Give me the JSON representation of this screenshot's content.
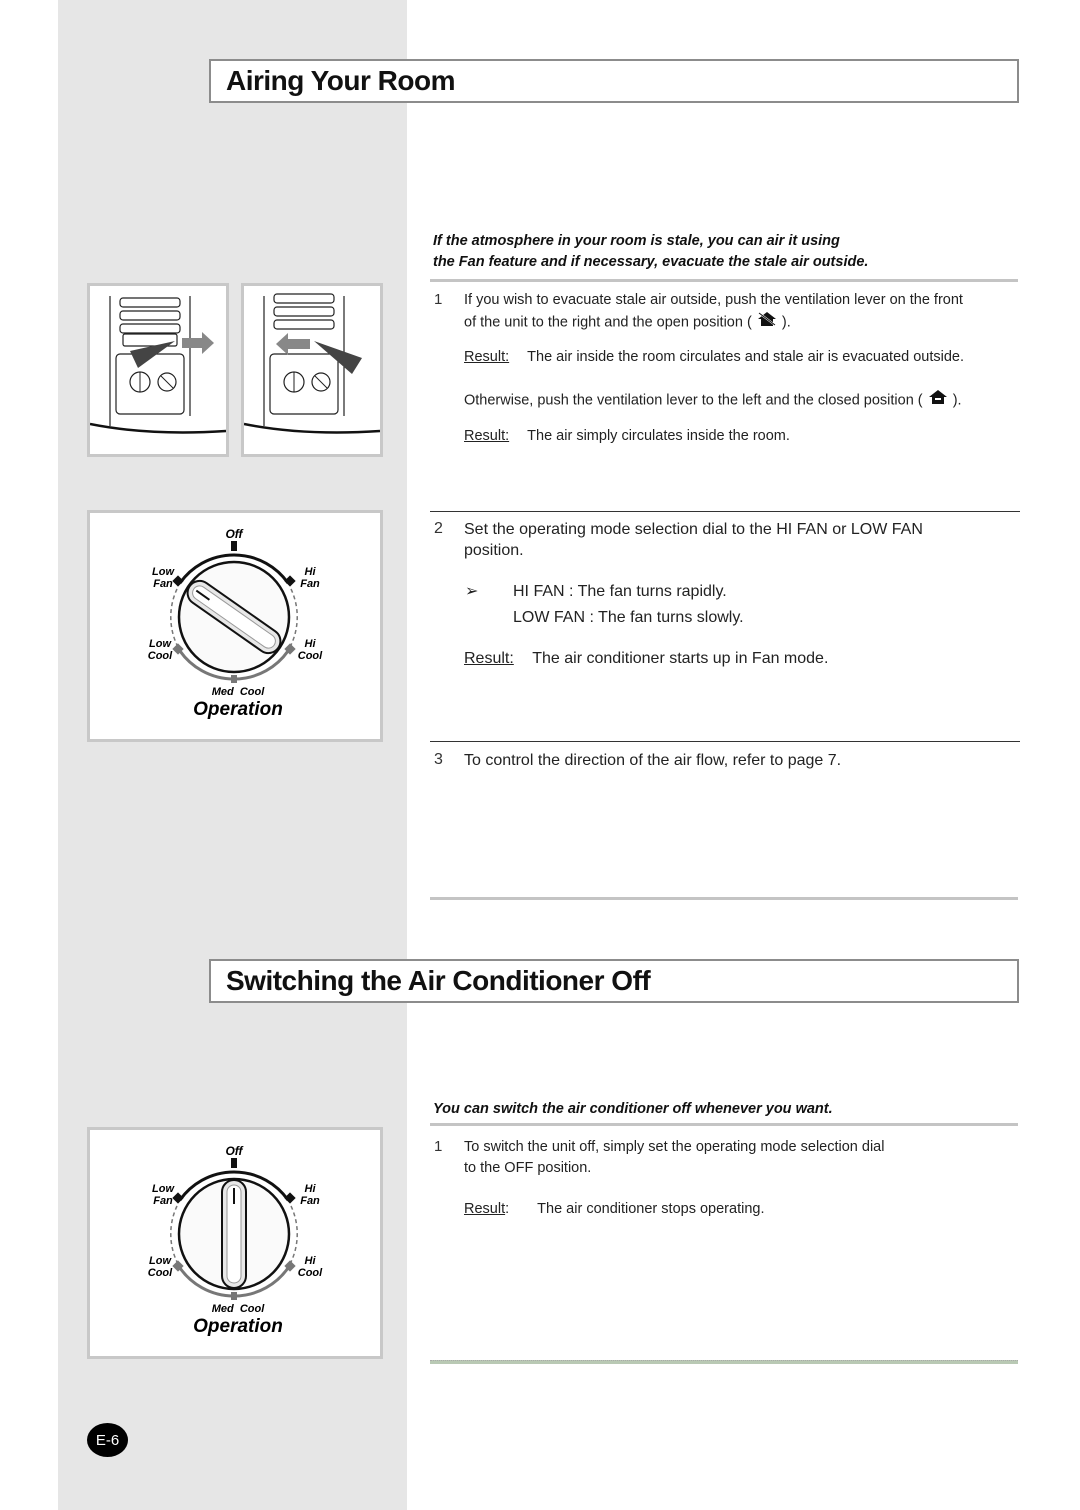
{
  "section1": {
    "title": "Airing Your Room",
    "intro_line1": "If the atmosphere in your room is stale, you can air it using",
    "intro_line2": "the Fan feature and if necessary, evacuate the stale air outside.",
    "step1": {
      "number": "1",
      "line1": "If you wish to evacuate stale air outside, push the ventilation lever on the front",
      "line2_pre": "of the unit to the right and the open position (",
      "line2_post": ").",
      "open_icon": "vent-open-house-icon",
      "result_label": "Result:",
      "result_text": "The air inside the room circulates and stale air is evacuated outside.",
      "otherwise_pre": "Otherwise, push the ventilation lever to the left and the closed position (",
      "otherwise_post": ").",
      "closed_icon": "vent-closed-house-icon",
      "result2_label": "Result:",
      "result2_text": "The air simply circulates inside the room."
    },
    "step2": {
      "number": "2",
      "line1": "Set the operating mode selection dial to the HI FAN or LOW FAN",
      "line2": "position.",
      "note_icon": "arrow-bullet-icon",
      "note1": "HI FAN : The fan turns rapidly.",
      "note2": "LOW FAN : The fan turns slowly.",
      "result_label": "Result:",
      "result_text": "The air conditioner starts up in Fan mode."
    },
    "step3": {
      "number": "3",
      "text": "To control the direction of the air flow, refer to page 7."
    }
  },
  "section2": {
    "title": "Switching the Air Conditioner Off",
    "intro": "You can switch the air conditioner off whenever you want.",
    "step1": {
      "number": "1",
      "line1": "To switch the unit off, simply set the operating mode selection dial",
      "line2": "to the OFF position.",
      "result_label": "Result",
      "result_colon": ":",
      "result_text": "The air conditioner stops operating."
    }
  },
  "dial": {
    "off": "Off",
    "low_fan_1": "Low",
    "low_fan_2": "Fan",
    "hi_fan_1": "Hi",
    "hi_fan_2": "Fan",
    "low_cool_1": "Low",
    "low_cool_2": "Cool",
    "hi_cool_1": "Hi",
    "hi_cool_2": "Cool",
    "med_cool": "Med  Cool",
    "caption": "Operation"
  },
  "page_number": "E-6"
}
